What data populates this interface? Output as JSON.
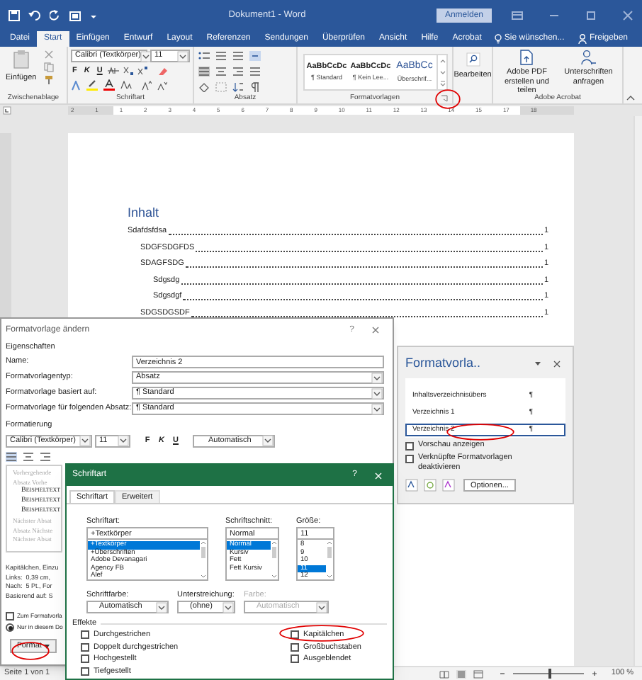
{
  "window": {
    "title": "Dokument1 - Word",
    "sign_in_button": "Anmelden"
  },
  "tabs": [
    {
      "label": "Datei",
      "selected": false
    },
    {
      "label": "Start",
      "selected": true
    },
    {
      "label": "Einfügen",
      "selected": false
    },
    {
      "label": "Entwurf",
      "selected": false
    },
    {
      "label": "Layout",
      "selected": false
    },
    {
      "label": "Referenzen",
      "selected": false
    },
    {
      "label": "Sendungen",
      "selected": false
    },
    {
      "label": "Überprüfen",
      "selected": false
    },
    {
      "label": "Ansicht",
      "selected": false
    },
    {
      "label": "Hilfe",
      "selected": false
    },
    {
      "label": "Acrobat",
      "selected": false
    }
  ],
  "tell_me": "Sie wünschen...",
  "share": "Freigeben",
  "ribbon": {
    "clipboard": {
      "paste": "Einfügen",
      "label": "Zwischenablage"
    },
    "font": {
      "name": "Calibri (Textkörper)",
      "size": "11",
      "buttons": [
        "F",
        "K",
        "U"
      ],
      "label": "Schriftart"
    },
    "paragraph": {
      "label": "Absatz"
    },
    "styles": {
      "items": [
        {
          "sample": "AaBbCcDc",
          "name": "¶ Standard",
          "kind": "body"
        },
        {
          "sample": "AaBbCcDc",
          "name": "¶ Kein Lee...",
          "kind": "body"
        },
        {
          "sample": "AaBbCc",
          "name": "Überschrif...",
          "kind": "heading"
        }
      ],
      "label": "Formatvorlagen"
    },
    "editing": {
      "label": "Bearbeiten"
    },
    "acrobat": {
      "buttons": [
        "Adobe PDF erstellen und teilen",
        "Unterschriften anfragen"
      ],
      "label": "Adobe Acrobat"
    }
  },
  "ruler": [
    "2",
    "1",
    "1",
    "2",
    "3",
    "4",
    "5",
    "6",
    "7",
    "8",
    "9",
    "10",
    "11",
    "12",
    "13",
    "14",
    "15",
    "17",
    "18"
  ],
  "document": {
    "heading": "Inhalt",
    "toc": [
      {
        "text": "Sdafdsfdsa",
        "page": "1",
        "children": [
          {
            "text": "SDGFSDGFDS",
            "page": "1"
          },
          {
            "text": "SDAGFSDG",
            "page": "1",
            "children": [
              {
                "text": "Sdgsdg",
                "page": "1"
              },
              {
                "text": "Sdgsdgf",
                "page": "1"
              }
            ]
          },
          {
            "text": "SDGSDGSDF",
            "page": "1"
          }
        ]
      }
    ]
  },
  "modify_style_dialog": {
    "title": "Formatvorlage ändern",
    "help": "?",
    "properties_label": "Eigenschaften",
    "fields": [
      {
        "label": "Name:",
        "value": "Verzeichnis 2",
        "kind": "text"
      },
      {
        "label": "Formatvorlagentyp:",
        "value": "Absatz",
        "kind": "select"
      },
      {
        "label": "Formatvorlage basiert auf:",
        "value": "¶ Standard",
        "kind": "select"
      },
      {
        "label": "Formatvorlage für folgenden Absatz:",
        "value": "¶ Standard",
        "kind": "select"
      }
    ],
    "formatting_label": "Formatierung",
    "font": "Calibri (Textkörper)",
    "size": "11",
    "buttons": [
      "F",
      "K",
      "U"
    ],
    "font_color_select": "Automatisch",
    "preview": [
      {
        "text": "Vorhergehende",
        "kind": "faded"
      },
      {
        "text": "Absatz Vorhe",
        "kind": "faded"
      },
      {
        "text": "Beispieltext",
        "kind": "sample"
      },
      {
        "text": "Beispieltext",
        "kind": "sample"
      },
      {
        "text": "Beispieltext",
        "kind": "sample"
      },
      {
        "text": "Nächster Absat",
        "kind": "faded"
      },
      {
        "text": "Absatz Nächste",
        "kind": "faded"
      },
      {
        "text": "Nächster Absat",
        "kind": "faded"
      }
    ],
    "description": [
      "Kapitälchen, Einzu",
      "Links:  0,39 cm,",
      "Nach:  5 Pt., For",
      "Basierend auf: S"
    ],
    "add_to_gallery": {
      "label": "Zum Formatvorla",
      "checked": false
    },
    "only_this_document": {
      "label": "Nur in diesem Do",
      "selected": true
    },
    "format_button": "Format"
  },
  "font_dialog": {
    "title": "Schriftart",
    "help": "?",
    "tabs": [
      {
        "label": "Schriftart",
        "selected": true
      },
      {
        "label": "Erweitert",
        "selected": false
      }
    ],
    "lists": [
      {
        "label": "Schriftart:",
        "value": "+Textkörper",
        "options": [
          {
            "text": "+Textkörper",
            "selected": true
          },
          {
            "text": "+Überschriften",
            "selected": false
          },
          {
            "text": "Adobe Devanagari",
            "selected": false
          },
          {
            "text": "Agency FB",
            "selected": false
          },
          {
            "text": "Alef",
            "selected": false
          }
        ]
      },
      {
        "label": "Schriftschnitt:",
        "value": "Normal",
        "options": [
          {
            "text": "Normal",
            "selected": true
          },
          {
            "text": "Kursiv",
            "selected": false
          },
          {
            "text": "Fett",
            "selected": false
          },
          {
            "text": "Fett Kursiv",
            "selected": false
          }
        ]
      },
      {
        "label": "Größe:",
        "value": "11",
        "options": [
          {
            "text": "8",
            "selected": false
          },
          {
            "text": "9",
            "selected": false
          },
          {
            "text": "10",
            "selected": false
          },
          {
            "text": "11",
            "selected": true
          },
          {
            "text": "12",
            "selected": false
          }
        ]
      }
    ],
    "selects": [
      {
        "label": "Schriftfarbe:",
        "value": "Automatisch",
        "disabled": false
      },
      {
        "label": "Unterstreichung:",
        "value": "(ohne)",
        "disabled": false
      },
      {
        "label": "Farbe:",
        "value": "Automatisch",
        "disabled": true
      }
    ],
    "effects_label": "Effekte",
    "effects_left": [
      {
        "label": "Durchgestrichen",
        "checked": false
      },
      {
        "label": "Doppelt durchgestrichen",
        "checked": false
      },
      {
        "label": "Hochgestellt",
        "checked": false
      },
      {
        "label": "Tiefgestellt",
        "checked": false
      }
    ],
    "effects_right": [
      {
        "label": "Kapitälchen",
        "checked": false
      },
      {
        "label": "Großbuchstaben",
        "checked": false
      },
      {
        "label": "Ausgeblendet",
        "checked": false
      }
    ]
  },
  "styles_pane": {
    "title": "Formatvorla..",
    "items": [
      {
        "label": "Inhaltsverzeichnisübers",
        "symbol": "¶",
        "selected": false
      },
      {
        "label": "Verzeichnis 1",
        "symbol": "¶",
        "selected": false
      },
      {
        "label": "Verzeichnis 2",
        "symbol": "¶",
        "selected": true
      }
    ],
    "checkboxes": [
      {
        "label": "Vorschau anzeigen",
        "checked": false
      },
      {
        "label": "Verknüpfte Formatvorlagen deaktivieren",
        "checked": false
      }
    ],
    "options_button": "Optionen..."
  },
  "status_bar": {
    "page": "Seite 1 von 1",
    "zoom": "100 %",
    "level": 0.5
  }
}
